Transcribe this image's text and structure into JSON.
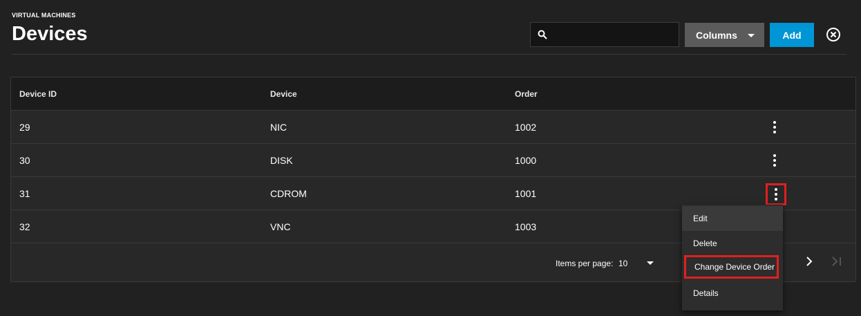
{
  "header": {
    "breadcrumb": "VIRTUAL MACHINES",
    "title": "Devices"
  },
  "toolbar": {
    "search_placeholder": "",
    "columns_label": "Columns",
    "add_label": "Add"
  },
  "table": {
    "headers": [
      "Device ID",
      "Device",
      "Order"
    ],
    "rows": [
      {
        "id": "29",
        "device": "NIC",
        "order": "1002"
      },
      {
        "id": "30",
        "device": "DISK",
        "order": "1000"
      },
      {
        "id": "31",
        "device": "CDROM",
        "order": "1001"
      },
      {
        "id": "32",
        "device": "VNC",
        "order": "1003"
      }
    ]
  },
  "paginator": {
    "items_per_page_label": "Items per page:",
    "items_per_page_value": "10"
  },
  "menu": {
    "items": [
      "Edit",
      "Delete",
      "Change Device Order",
      "Details"
    ]
  },
  "colors": {
    "background": "#212121",
    "accent": "#0095d5",
    "highlight": "#e02020"
  },
  "icons": {
    "search": "search-icon",
    "close": "close-circle-icon",
    "row_menu": "more-vertical-icon",
    "next": "chevron-right-icon",
    "last": "last-page-icon"
  }
}
